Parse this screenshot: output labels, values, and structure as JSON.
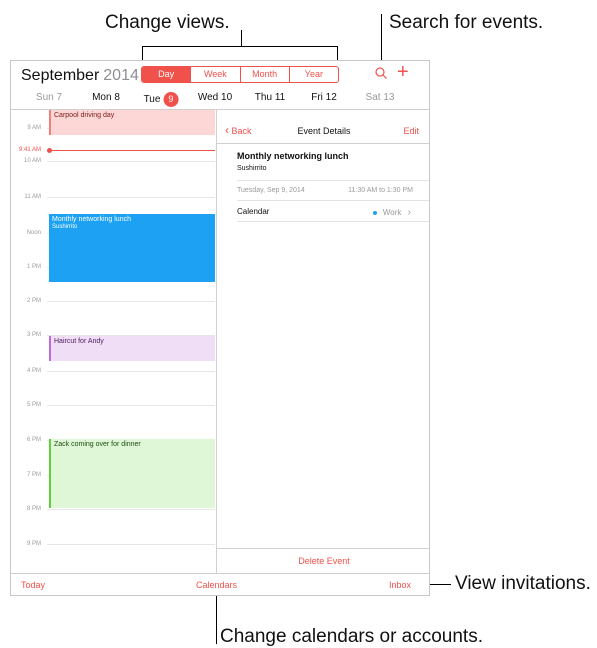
{
  "callouts": {
    "change_views": "Change views.",
    "search_events": "Search for events.",
    "view_invitations": "View invitations.",
    "change_calendars": "Change calendars or accounts."
  },
  "header": {
    "month": "September",
    "year": "2014",
    "segments": [
      "Day",
      "Week",
      "Month",
      "Year"
    ],
    "selected_segment": "Day"
  },
  "week": {
    "days": [
      "Sun 7",
      "Mon 8",
      "Tue",
      "Wed 10",
      "Thu 11",
      "Fri 12",
      "Sat 13"
    ],
    "today_number": "9"
  },
  "timeline": {
    "hours": [
      "9 AM",
      "10 AM",
      "11 AM",
      "Noon",
      "1 PM",
      "2 PM",
      "3 PM",
      "4 PM",
      "5 PM",
      "6 PM",
      "7 PM",
      "8 PM",
      "9 PM"
    ],
    "now_label": "9:41 AM"
  },
  "events": [
    {
      "title": "Carpool driving day",
      "subtitle": ""
    },
    {
      "title": "Monthly networking lunch",
      "subtitle": "Sushirrito"
    },
    {
      "title": "Haircut for Andy",
      "subtitle": ""
    },
    {
      "title": "Zack coming over for dinner",
      "subtitle": ""
    }
  ],
  "detail": {
    "back": "Back",
    "title": "Event Details",
    "edit": "Edit",
    "event_name": "Monthly networking lunch",
    "location": "Sushirrito",
    "date": "Tuesday, Sep 9, 2014",
    "time": "11:30 AM to 1:30 PM",
    "calendar_label": "Calendar",
    "calendar_value": "Work",
    "delete": "Delete Event"
  },
  "toolbar": {
    "today": "Today",
    "calendars": "Calendars",
    "inbox": "Inbox"
  },
  "colors": {
    "accent": "#f0514b",
    "work_calendar": "#1da1f2"
  }
}
